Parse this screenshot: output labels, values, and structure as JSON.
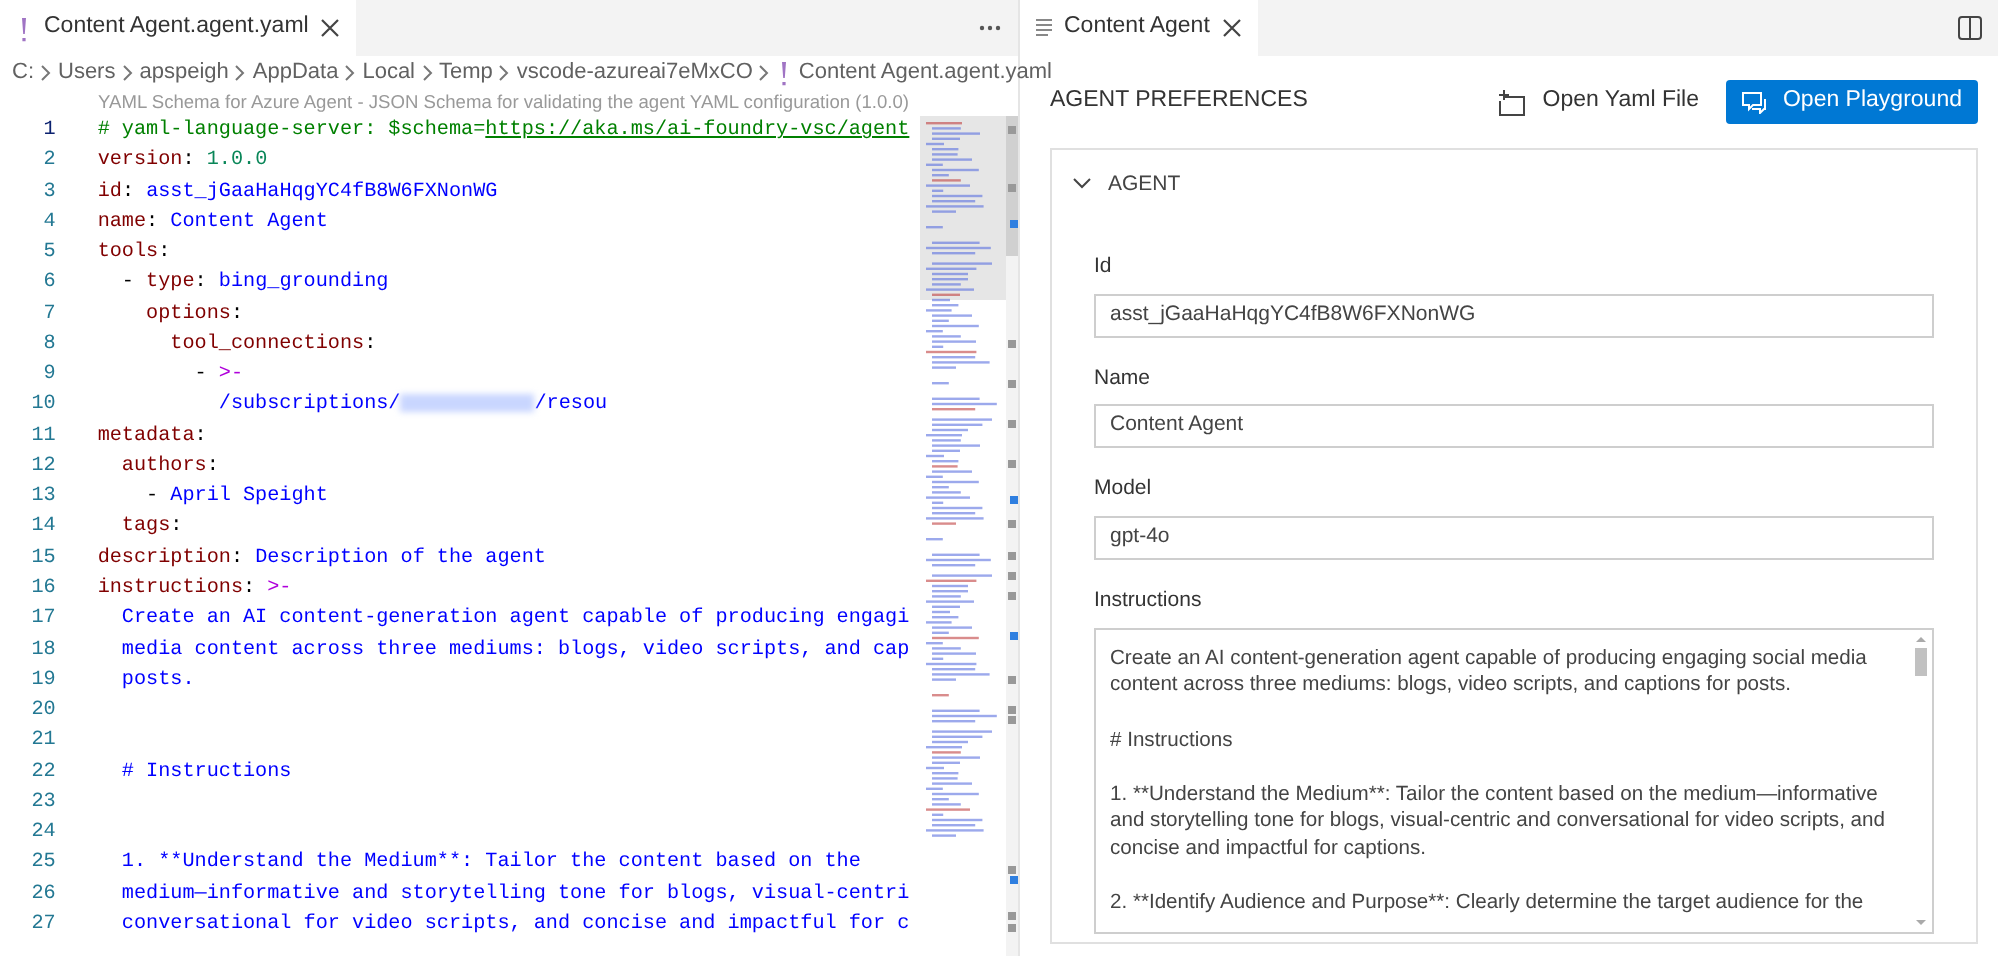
{
  "editor": {
    "tab": {
      "title": "Content Agent.agent.yaml",
      "selected": true
    },
    "breadcrumb": [
      "C:",
      "Users",
      "apspeigh",
      "AppData",
      "Local",
      "Temp",
      "vscode-azureai7eMxCO",
      "Content Agent.agent.yaml"
    ],
    "codelens": "YAML Schema for Azure Agent - JSON Schema for validating the agent YAML configuration (1.0.0)",
    "lines": [
      {
        "number": "1",
        "active": true,
        "tokens": [
          {
            "kind": "comment",
            "text": "# yaml-language-server: $schema="
          },
          {
            "kind": "link",
            "text": "https://aka.ms/ai-foundry-vsc/agent"
          }
        ]
      },
      {
        "number": "2",
        "active": false,
        "tokens": [
          {
            "kind": "key",
            "text": "version"
          },
          {
            "kind": "punct",
            "text": ": "
          },
          {
            "kind": "number",
            "text": "1.0.0"
          }
        ]
      },
      {
        "number": "3",
        "active": false,
        "tokens": [
          {
            "kind": "key",
            "text": "id"
          },
          {
            "kind": "punct",
            "text": ": "
          },
          {
            "kind": "value",
            "text": "asst_jGaaHaHqgYC4fB8W6FXNonWG"
          }
        ]
      },
      {
        "number": "4",
        "active": false,
        "tokens": [
          {
            "kind": "key",
            "text": "name"
          },
          {
            "kind": "punct",
            "text": ": "
          },
          {
            "kind": "value",
            "text": "Content Agent"
          }
        ]
      },
      {
        "number": "5",
        "active": false,
        "tokens": [
          {
            "kind": "key",
            "text": "tools"
          },
          {
            "kind": "punct",
            "text": ":"
          }
        ]
      },
      {
        "number": "6",
        "active": false,
        "tokens": [
          {
            "kind": "punct",
            "text": "  - "
          },
          {
            "kind": "key",
            "text": "type"
          },
          {
            "kind": "punct",
            "text": ": "
          },
          {
            "kind": "value",
            "text": "bing_grounding"
          }
        ]
      },
      {
        "number": "7",
        "active": false,
        "tokens": [
          {
            "kind": "key",
            "text": "    options"
          },
          {
            "kind": "punct",
            "text": ":"
          }
        ]
      },
      {
        "number": "8",
        "active": false,
        "tokens": [
          {
            "kind": "key",
            "text": "      tool_connections"
          },
          {
            "kind": "punct",
            "text": ":"
          }
        ]
      },
      {
        "number": "9",
        "active": false,
        "tokens": [
          {
            "kind": "punct",
            "text": "        - "
          },
          {
            "kind": "indicator",
            "text": ">-"
          }
        ]
      },
      {
        "number": "10",
        "active": false,
        "tokens": [
          {
            "kind": "value",
            "text": "          /subscriptions/"
          },
          {
            "kind": "redacted"
          },
          {
            "kind": "value",
            "text": "/resou"
          }
        ]
      },
      {
        "number": "11",
        "active": false,
        "tokens": [
          {
            "kind": "key",
            "text": "metadata"
          },
          {
            "kind": "punct",
            "text": ":"
          }
        ]
      },
      {
        "number": "12",
        "active": false,
        "tokens": [
          {
            "kind": "key",
            "text": "  authors"
          },
          {
            "kind": "punct",
            "text": ":"
          }
        ]
      },
      {
        "number": "13",
        "active": false,
        "tokens": [
          {
            "kind": "punct",
            "text": "    - "
          },
          {
            "kind": "value",
            "text": "April Speight"
          }
        ]
      },
      {
        "number": "14",
        "active": false,
        "tokens": [
          {
            "kind": "key",
            "text": "  tags"
          },
          {
            "kind": "punct",
            "text": ":"
          }
        ]
      },
      {
        "number": "15",
        "active": false,
        "tokens": [
          {
            "kind": "key",
            "text": "description"
          },
          {
            "kind": "punct",
            "text": ": "
          },
          {
            "kind": "value",
            "text": "Description of the agent"
          }
        ]
      },
      {
        "number": "16",
        "active": false,
        "tokens": [
          {
            "kind": "key",
            "text": "instructions"
          },
          {
            "kind": "punct",
            "text": ": "
          },
          {
            "kind": "indicator",
            "text": ">-"
          }
        ]
      },
      {
        "number": "17",
        "active": false,
        "tokens": [
          {
            "kind": "value",
            "text": "  Create an AI content-generation agent capable of producing engagi"
          }
        ]
      },
      {
        "number": "18",
        "active": false,
        "tokens": [
          {
            "kind": "value",
            "text": "  media content across three mediums: blogs, video scripts, and cap"
          }
        ]
      },
      {
        "number": "19",
        "active": false,
        "tokens": [
          {
            "kind": "value",
            "text": "  posts."
          }
        ]
      },
      {
        "number": "20",
        "active": false
      },
      {
        "number": "21",
        "active": false
      },
      {
        "number": "22",
        "active": false,
        "tokens": [
          {
            "kind": "value",
            "text": "  # Instructions"
          }
        ]
      },
      {
        "number": "23",
        "active": false
      },
      {
        "number": "24",
        "active": false
      },
      {
        "number": "25",
        "active": false,
        "tokens": [
          {
            "kind": "value",
            "text": "  1. **Understand the Medium**: Tailor the content based on the"
          }
        ]
      },
      {
        "number": "26",
        "active": false,
        "tokens": [
          {
            "kind": "value",
            "text": "  medium—informative and storytelling tone for blogs, visual-centri"
          }
        ]
      },
      {
        "number": "27",
        "active": false,
        "tokens": [
          {
            "kind": "value",
            "text": "  conversational for video scripts, and concise and impactful for c"
          }
        ]
      }
    ]
  },
  "panel": {
    "tab": {
      "title": "Content Agent",
      "selected": true
    },
    "title": "AGENT PREFERENCES",
    "buttons": [
      {
        "label": "Open Yaml File",
        "kind": "secondary"
      },
      {
        "label": "Open Playground",
        "kind": "primary"
      }
    ],
    "section": {
      "title": "AGENT",
      "expanded": true,
      "fields": [
        {
          "label": "Id",
          "kind": "input",
          "value": "asst_jGaaHaHqgYC4fB8W6FXNonWG"
        },
        {
          "label": "Name",
          "kind": "input",
          "value": "Content Agent"
        },
        {
          "label": "Model",
          "kind": "input",
          "value": "gpt-4o"
        },
        {
          "label": "Instructions",
          "kind": "textarea",
          "paragraphs": [
            "Create an AI content-generation agent capable of producing engaging social media content across three mediums: blogs, video scripts, and captions for posts.",
            "# Instructions",
            "1. **Understand the Medium**: Tailor the content based on the medium—informative and storytelling tone for blogs, visual-centric and conversational for video scripts, and concise and impactful for captions.",
            "2. **Identify Audience and Purpose**: Clearly determine the target audience for the"
          ]
        }
      ]
    }
  }
}
